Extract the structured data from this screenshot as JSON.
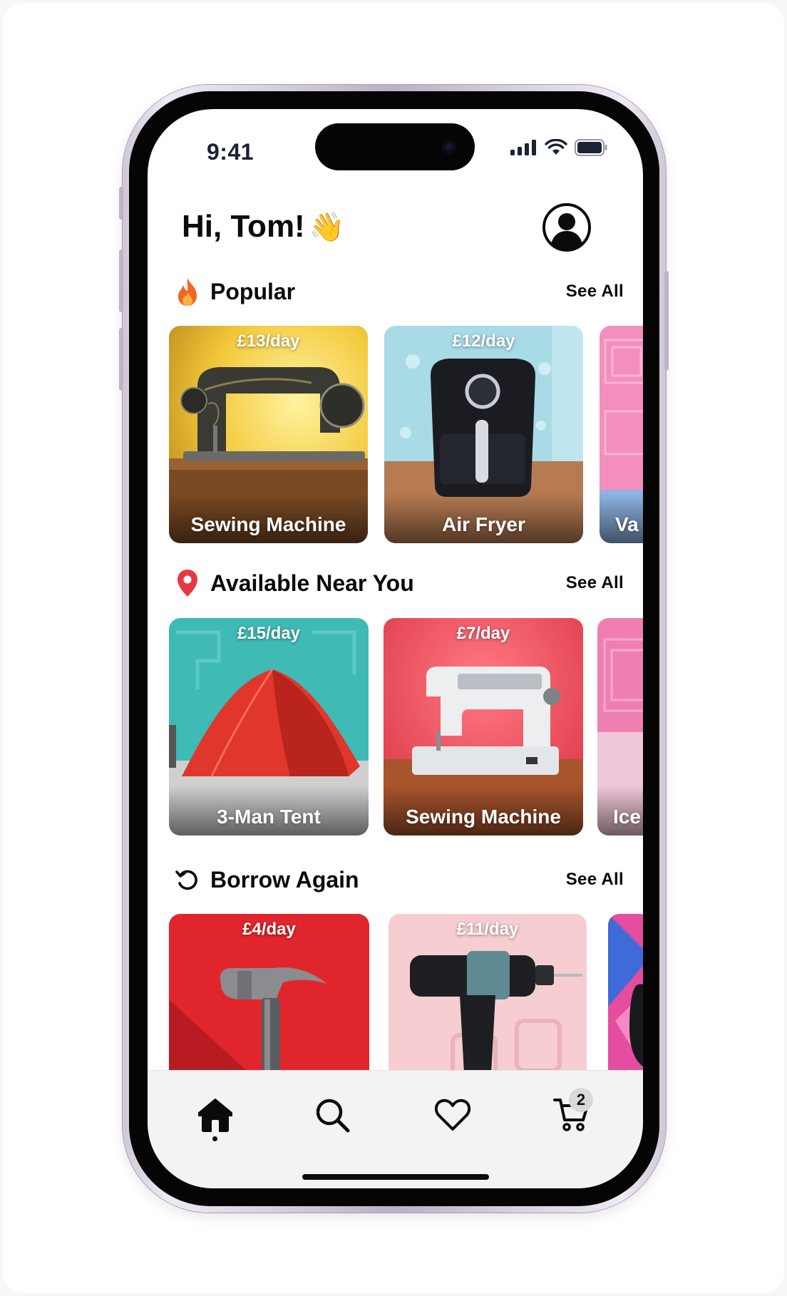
{
  "status_bar": {
    "time": "9:41"
  },
  "header": {
    "greeting": "Hi, Tom!",
    "emoji": "👋"
  },
  "sections": [
    {
      "title": "Popular",
      "icon": "fire-icon",
      "see_all": "See All",
      "items": [
        {
          "price": "£13/day",
          "name": "Sewing Machine"
        },
        {
          "price": "£12/day",
          "name": "Air Fryer"
        },
        {
          "price": "",
          "name": "Va"
        }
      ]
    },
    {
      "title": "Available Near You",
      "icon": "location-pin-icon",
      "see_all": "See All",
      "items": [
        {
          "price": "£15/day",
          "name": "3-Man Tent"
        },
        {
          "price": "£7/day",
          "name": "Sewing Machine"
        },
        {
          "price": "",
          "name": "Ice"
        }
      ]
    },
    {
      "title": "Borrow Again",
      "icon": "history-icon",
      "see_all": "See All",
      "items": [
        {
          "price": "£4/day",
          "name": ""
        },
        {
          "price": "£11/day",
          "name": ""
        },
        {
          "price": "",
          "name": ""
        }
      ]
    }
  ],
  "tab_bar": {
    "tabs": [
      "home-icon",
      "search-icon",
      "heart-icon",
      "cart-icon"
    ],
    "active_tab": "home-icon",
    "cart_badge": "2"
  },
  "colors": {
    "accent_red": "#e63946",
    "text": "#0b0b0b",
    "tab_bar_bg": "#f3f3f4"
  }
}
